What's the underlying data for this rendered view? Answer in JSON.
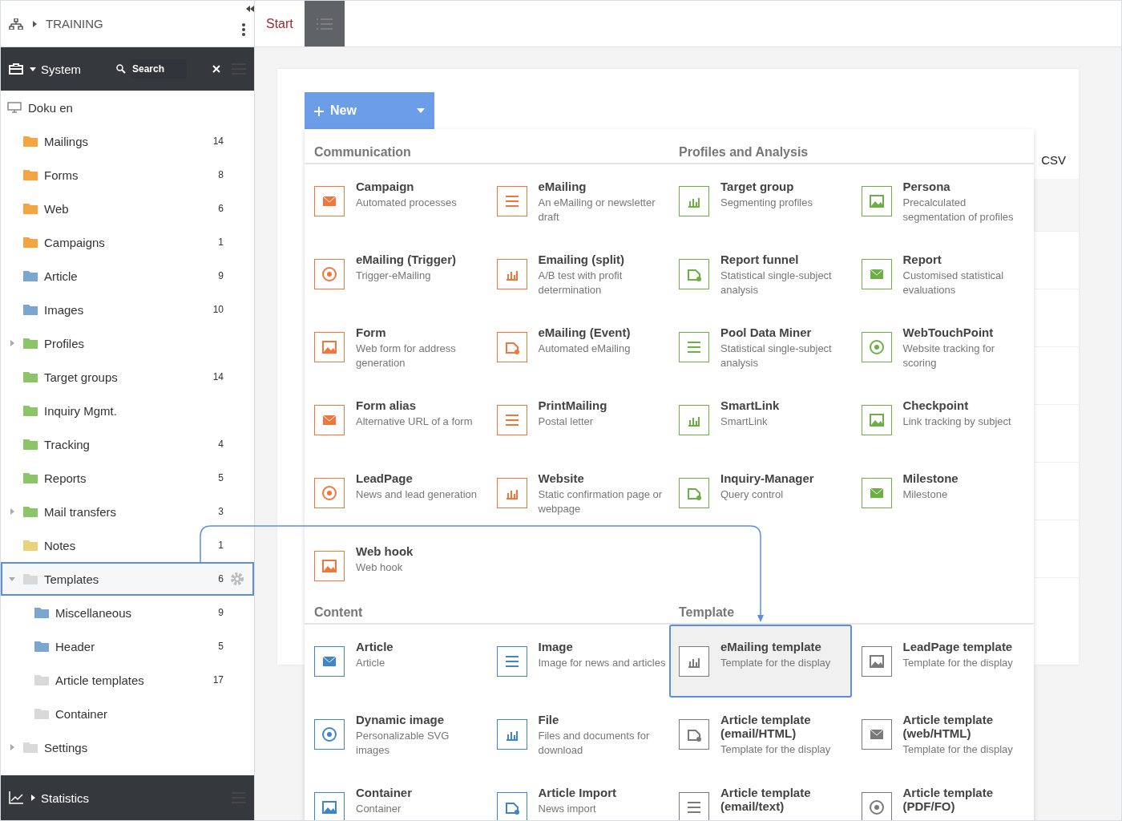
{
  "sidebar": {
    "title": "TRAINING",
    "system": {
      "label": "System",
      "search": {
        "placeholder": "Search"
      },
      "expanded": true
    },
    "tree": {
      "root": "Doku en",
      "items": [
        {
          "label": "Mailings",
          "count": "14",
          "color": "#f5a540",
          "selected": false
        },
        {
          "label": "Forms",
          "count": "8",
          "color": "#f5a540",
          "selected": false
        },
        {
          "label": "Web",
          "count": "6",
          "color": "#f5a540",
          "selected": false
        },
        {
          "label": "Campaigns",
          "count": "1",
          "color": "#f5a540",
          "selected": false
        },
        {
          "label": "Article",
          "count": "9",
          "color": "#7aa6cf",
          "selected": false
        },
        {
          "label": "Images",
          "count": "10",
          "color": "#7aa6cf",
          "selected": false
        },
        {
          "label": "Profiles",
          "color": "#8cc568",
          "expanded": false,
          "selected": false
        },
        {
          "label": "Target groups",
          "count": "14",
          "color": "#8cc568",
          "selected": false
        },
        {
          "label": "Inquiry Mgmt.",
          "color": "#8cc568",
          "selected": false
        },
        {
          "label": "Tracking",
          "count": "4",
          "color": "#8cc568",
          "selected": false
        },
        {
          "label": "Reports",
          "count": "5",
          "color": "#8cc568",
          "selected": false
        },
        {
          "label": "Mail transfers",
          "count": "3",
          "color": "#8cc568",
          "expanded": false,
          "selected": false
        },
        {
          "label": "Notes",
          "count": "1",
          "color": "#e8d27c",
          "selected": false
        },
        {
          "label": "Templates",
          "count": "6",
          "color": "#d9d9d9",
          "expanded": true,
          "selected": true,
          "children": [
            {
              "label": "Miscellaneous",
              "count": "9",
              "color": "#7aa6cf",
              "selected": false
            },
            {
              "label": "Header",
              "count": "5",
              "color": "#7aa6cf",
              "selected": false
            },
            {
              "label": "Article templates",
              "count": "17",
              "color": "#d9d9d9",
              "selected": false
            },
            {
              "label": "Container",
              "color": "#d9d9d9",
              "selected": false
            }
          ]
        },
        {
          "label": "Settings",
          "color": "#d9d9d9",
          "expanded": false,
          "selected": false
        }
      ]
    },
    "statistics": {
      "label": "Statistics",
      "expanded": false
    }
  },
  "tabs": [
    {
      "label": "Start",
      "selected": true
    }
  ],
  "new_button": {
    "label": "New"
  },
  "table": {
    "columns": [
      "CSV"
    ]
  },
  "menu": {
    "blocks": [
      {
        "groups": [
          {
            "title": "Communication",
            "color": "#f0763a",
            "items": [
              {
                "title": "Campaign",
                "description": "Automated processes",
                "selected": false
              },
              {
                "title": "eMailing",
                "description": "An eMailing or newsletter draft",
                "selected": false
              },
              {
                "title": "eMailing (Trigger)",
                "description": "Trigger-eMailing",
                "selected": false
              },
              {
                "title": "Emailing (split)",
                "description": "A/B test with profit determination",
                "selected": false
              },
              {
                "title": "Form",
                "description": "Web form for address generation",
                "selected": false
              },
              {
                "title": "eMailing (Event)",
                "description": "Automated eMailing",
                "selected": false
              },
              {
                "title": "Form alias",
                "description": "Alternative URL of a form",
                "selected": false
              },
              {
                "title": "PrintMailing",
                "description": "Postal letter",
                "selected": false
              },
              {
                "title": "LeadPage",
                "description": "News and lead generation",
                "selected": false
              },
              {
                "title": "Website",
                "description": "Static confirmation page or webpage",
                "selected": false
              },
              {
                "title": "Web hook",
                "description": "Web hook",
                "selected": false
              }
            ]
          },
          {
            "title": "Profiles and Analysis",
            "color": "#6cb043",
            "items": [
              {
                "title": "Target group",
                "description": "Segmenting profiles",
                "selected": false
              },
              {
                "title": "Persona",
                "description": "Precalculated segmentation of profiles",
                "selected": false
              },
              {
                "title": "Report funnel",
                "description": "Statistical single-subject analysis",
                "selected": false
              },
              {
                "title": "Report",
                "description": "Customised statistical evaluations",
                "selected": false
              },
              {
                "title": "Pool Data Miner",
                "description": "Statistical single-subject analysis",
                "selected": false
              },
              {
                "title": "WebTouchPoint",
                "description": "Website tracking for scoring",
                "selected": false
              },
              {
                "title": "SmartLink",
                "description": "SmartLink",
                "selected": false
              },
              {
                "title": "Checkpoint",
                "description": "Link tracking by subject",
                "selected": false
              },
              {
                "title": "Inquiry-Manager",
                "description": "Query control",
                "selected": false
              },
              {
                "title": "Milestone",
                "description": "Milestone",
                "selected": false
              }
            ]
          }
        ]
      },
      {
        "groups": [
          {
            "title": "Content",
            "color": "#3f86c9",
            "items": [
              {
                "title": "Article",
                "description": "Article",
                "selected": false
              },
              {
                "title": "Image",
                "description": "Image for news and articles",
                "selected": false
              },
              {
                "title": "Dynamic image",
                "description": "Personalizable SVG images",
                "selected": false
              },
              {
                "title": "File",
                "description": "Files and documents for download",
                "selected": false
              },
              {
                "title": "Container",
                "description": "Container",
                "selected": false
              },
              {
                "title": "Article Import",
                "description": "News import",
                "selected": false
              }
            ]
          },
          {
            "title": "Template",
            "color": "#7a7a7a",
            "items": [
              {
                "title": "eMailing template",
                "description": "Template for the display",
                "selected": true
              },
              {
                "title": "LeadPage template",
                "description": "Template for the display",
                "selected": false
              },
              {
                "title": "Article template (email/HTML)",
                "description": "Template for the display",
                "selected": false
              },
              {
                "title": "Article template (web/HTML)",
                "description": "Template for the display",
                "selected": false
              },
              {
                "title": "Article template (email/text)",
                "selected": false
              },
              {
                "title": "Article template (PDF/FO)",
                "selected": false
              }
            ]
          }
        ]
      }
    ]
  }
}
